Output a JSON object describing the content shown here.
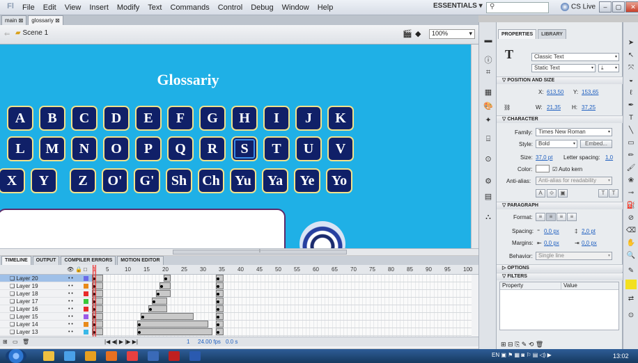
{
  "menubar": {
    "logo": "Fl",
    "items": [
      "File",
      "Edit",
      "View",
      "Insert",
      "Modify",
      "Text",
      "Commands",
      "Control",
      "Debug",
      "Window",
      "Help"
    ],
    "workspace": "ESSENTIALS ▾",
    "search_placeholder": "",
    "cs_live": "CS Live"
  },
  "doc_tabs": [
    "main",
    "glossariy"
  ],
  "scene": {
    "label": "Scene 1",
    "zoom": "100%"
  },
  "stage": {
    "title": "Glossariy",
    "rows": [
      [
        "A",
        "B",
        "C",
        "D",
        "E",
        "F",
        "G",
        "H",
        "I",
        "J",
        "K"
      ],
      [
        "L",
        "M",
        "N",
        "O",
        "P",
        "Q",
        "R",
        "S",
        "T",
        "U",
        "V"
      ],
      [
        "X",
        "Y",
        "Z",
        "O'",
        "G'",
        "Sh",
        "Ch",
        "Yu",
        "Ya",
        "Ye",
        "Yo"
      ]
    ],
    "selected_key": "S",
    "bg_color": "#1fb0e6",
    "key_color": "#102068",
    "key_border": "#f3e28a"
  },
  "timeline_tabs": [
    "TIMELINE",
    "OUTPUT",
    "COMPILER ERRORS",
    "MOTION EDITOR"
  ],
  "timeline": {
    "frame_numbers": [
      "5",
      "10",
      "15",
      "20",
      "25",
      "30",
      "35",
      "40",
      "45",
      "50",
      "55",
      "60",
      "65",
      "70",
      "75",
      "80",
      "85",
      "90",
      "95",
      "100"
    ],
    "current_frame_marker": "1",
    "layers": [
      "Layer 20",
      "Layer 19",
      "Layer 18",
      "Layer 17",
      "Layer 16",
      "Layer 15",
      "Layer 14",
      "Layer 13"
    ],
    "selected_layer": "Layer 20",
    "layer_colors": [
      "#6a6ae8",
      "#e88a1a",
      "#e82a2a",
      "#3ac83a",
      "#e82a2a",
      "#9a5ae8",
      "#e88a1a",
      "#3ab8e8"
    ],
    "footer": {
      "frame": "1",
      "fps": "24.00 fps",
      "time": "0.0 s"
    }
  },
  "properties": {
    "tabs": [
      "PROPERTIES",
      "LIBRARY"
    ],
    "text_engine": "Classic Text",
    "text_type": "Static Text",
    "sections": {
      "position": "POSITION AND SIZE",
      "character": "CHARACTER",
      "paragraph": "PARAGRAPH",
      "options": "OPTIONS",
      "filters": "FILTERS"
    },
    "x_label": "X:",
    "x": "613,50",
    "y_label": "Y:",
    "y": "153,65",
    "w_label": "W:",
    "w": "21,35",
    "h_label": "H:",
    "h": "37,25",
    "family_label": "Family:",
    "family": "Times New Roman",
    "style_label": "Style:",
    "style": "Bold",
    "embed": "Embed...",
    "size_label": "Size:",
    "size": "37,0 pt",
    "letter_spacing_label": "Letter spacing:",
    "letter_spacing": "1,0",
    "color_label": "Color:",
    "auto_kern": "Auto kern",
    "anti_alias_label": "Anti-alias:",
    "anti_alias": "Anti-alias for readability",
    "format_label": "Format:",
    "spacing_label": "Spacing:",
    "spacing_indent": "0,0 px",
    "spacing_line": "2,0 pt",
    "margins_label": "Margins:",
    "margin_left": "0,0 px",
    "margin_right": "0,0 px",
    "behavior_label": "Behavior:",
    "behavior": "Single line",
    "filter_cols": [
      "Property",
      "Value"
    ]
  },
  "taskbar": {
    "lang": "EN",
    "clock": "13:02"
  }
}
